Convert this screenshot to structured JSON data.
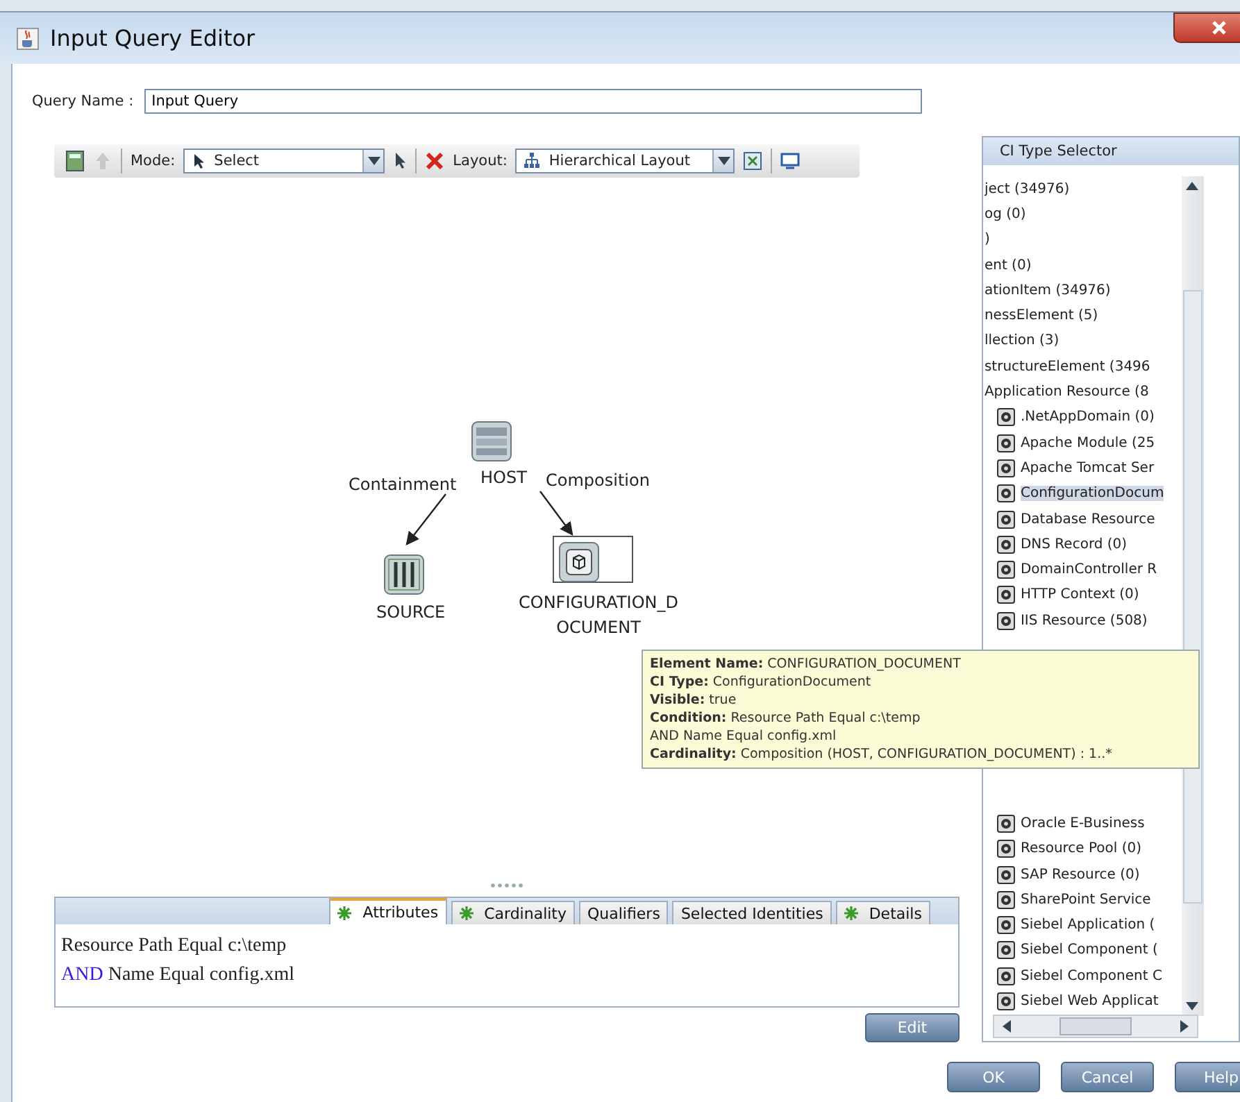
{
  "window": {
    "title": "Input Query Editor"
  },
  "query_name": {
    "label": "Query Name :",
    "value": "Input Query"
  },
  "toolbar": {
    "mode_label": "Mode:",
    "mode_value": "Select",
    "layout_label": "Layout:",
    "layout_value": "Hierarchical Layout"
  },
  "graph": {
    "nodes": [
      {
        "label": "HOST",
        "selected": false
      },
      {
        "label": "SOURCE",
        "selected": false
      },
      {
        "label": "CONFIGURATION_DOCUMENT",
        "selected": true
      }
    ],
    "edges": [
      {
        "label": "Containment"
      },
      {
        "label": "Composition"
      }
    ]
  },
  "tooltip": [
    "**Element Name:** CONFIGURATION_DOCUMENT",
    "**CI Type:** ConfigurationDocument",
    "**Visible:** true",
    "**Condition:** Resource Path Equal c:\\temp",
    "AND Name Equal config.xml",
    "**Cardinality:** Composition (HOST, CONFIGURATION_DOCUMENT) : 1..*"
  ],
  "details": {
    "tabs": [
      {
        "label": "Attributes",
        "starred": true,
        "selected": true
      },
      {
        "label": "Cardinality",
        "starred": true,
        "selected": false
      },
      {
        "label": "Qualifiers",
        "starred": false,
        "selected": false
      },
      {
        "label": "Selected Identities",
        "starred": false,
        "selected": false
      },
      {
        "label": "Details",
        "starred": true,
        "selected": false
      }
    ],
    "lines": [
      {
        "text": "Resource Path Equal c:\\temp"
      },
      {
        "keyword": "AND",
        "text": "Name Equal config.xml"
      }
    ],
    "edit_button": "Edit"
  },
  "ci_type_selector": {
    "title": "CI Type Selector",
    "top_items": [
      {
        "label": "ject (34976)",
        "selected": false
      },
      {
        "label": "og (0)",
        "selected": false
      },
      {
        "label": ")",
        "selected": false
      },
      {
        "label": "ent (0)",
        "selected": false
      },
      {
        "label": "ationItem (34976)",
        "selected": false
      },
      {
        "label": "nessElement (5)",
        "selected": false
      },
      {
        "label": "llection (3)",
        "selected": false
      },
      {
        "label": "structureElement (3496",
        "selected": false
      },
      {
        "label": "Application Resource (8",
        "selected": false,
        "children": [
          {
            "label": ".NetAppDomain (0)",
            "selected": false
          },
          {
            "label": "Apache Module (25",
            "selected": false
          },
          {
            "label": "Apache Tomcat Ser",
            "selected": false
          },
          {
            "label": "ConfigurationDocum",
            "selected": true
          },
          {
            "label": "Database Resource",
            "selected": false
          },
          {
            "label": "DNS Record (0)",
            "selected": false
          },
          {
            "label": "DomainController R",
            "selected": false
          },
          {
            "label": "HTTP Context (0)",
            "selected": false
          },
          {
            "label": "IIS Resource (508)",
            "selected": false
          }
        ]
      }
    ],
    "bottom_items": [
      {
        "label": "Oracle E-Business",
        "selected": false
      },
      {
        "label": "Resource Pool (0)",
        "selected": false
      },
      {
        "label": "SAP Resource (0)",
        "selected": false
      },
      {
        "label": "SharePoint Service",
        "selected": false
      },
      {
        "label": "Siebel Application (",
        "selected": false
      },
      {
        "label": "Siebel Component (",
        "selected": false
      },
      {
        "label": "Siebel Component C",
        "selected": false
      },
      {
        "label": "Siebel Web Applicat",
        "selected": false
      }
    ]
  },
  "buttons": [
    "OK",
    "Cancel",
    "Help"
  ]
}
